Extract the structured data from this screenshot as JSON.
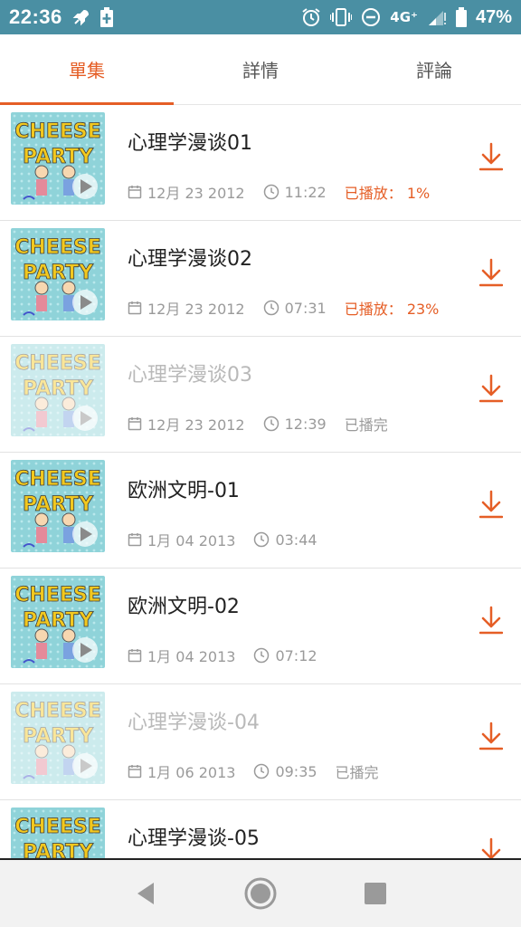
{
  "status_bar": {
    "time": "22:36",
    "network": "4G⁺",
    "battery_percent": "47%"
  },
  "tabs": [
    {
      "label": "單集",
      "active": true
    },
    {
      "label": "詳情",
      "active": false
    },
    {
      "label": "評論",
      "active": false
    }
  ],
  "episodes": [
    {
      "title": "心理学漫谈01",
      "date": "12月 23 2012",
      "duration": "11:22",
      "progress": "已播放： 1%",
      "progress_style": "orange",
      "played": false
    },
    {
      "title": "心理学漫谈02",
      "date": "12月 23 2012",
      "duration": "07:31",
      "progress": "已播放： 23%",
      "progress_style": "orange",
      "played": false
    },
    {
      "title": "心理学漫谈03",
      "date": "12月 23 2012",
      "duration": "12:39",
      "progress": "已播完",
      "progress_style": "gray",
      "played": true
    },
    {
      "title": "欧洲文明-01",
      "date": "1月 04 2013",
      "duration": "03:44",
      "progress": "",
      "progress_style": "none",
      "played": false
    },
    {
      "title": "欧洲文明-02",
      "date": "1月 04 2013",
      "duration": "07:12",
      "progress": "",
      "progress_style": "none",
      "played": false
    },
    {
      "title": "心理学漫谈-04",
      "date": "1月 06 2013",
      "duration": "09:35",
      "progress": "已播完",
      "progress_style": "gray",
      "played": true
    },
    {
      "title": "心理学漫谈-05",
      "date": "",
      "duration": "",
      "progress": "",
      "progress_style": "none",
      "played": false
    }
  ],
  "thumbnail_text": {
    "line1": "CHEESE",
    "line2": "PARTY"
  },
  "colors": {
    "accent": "#e55e26",
    "status_bar": "#4a8fa3"
  },
  "icons": {
    "back": "back-triangle-icon",
    "home": "home-circle-icon",
    "recents": "recents-square-icon",
    "download": "download-arrow-icon"
  }
}
